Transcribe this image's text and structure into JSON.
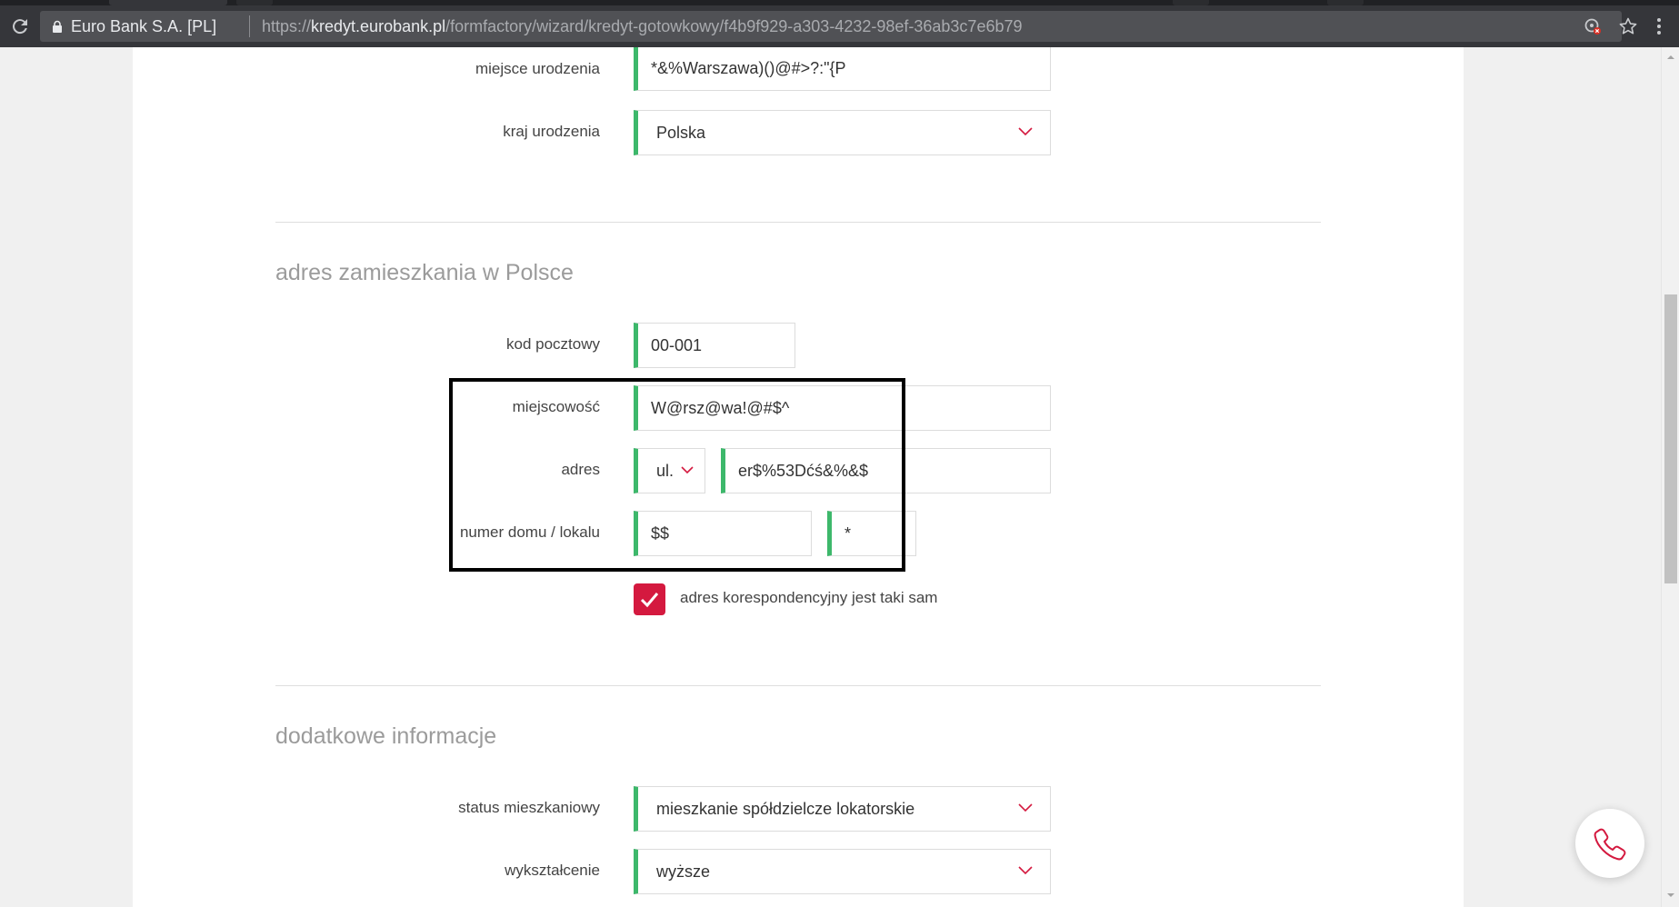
{
  "browser": {
    "site_name": "Euro Bank S.A. [PL]",
    "url_scheme": "https://",
    "url_host": "kredyt.eurobank.pl",
    "url_path": "/formfactory/wizard/kredyt-gotowkowy/f4b9f929-a303-4232-98ef-36ab3c7e6b79"
  },
  "form": {
    "birth_place": {
      "label": "miejsce urodzenia",
      "value": "*&%Warszawa)()@#>?:\"{P"
    },
    "birth_country": {
      "label": "kraj urodzenia",
      "value": "Polska"
    },
    "address_section": {
      "title": "adres zamieszkania w Polsce",
      "postal_code": {
        "label": "kod pocztowy",
        "value": "00-001"
      },
      "city": {
        "label": "miejscowość",
        "value": "W@rsz@wa!@#$^"
      },
      "address": {
        "label": "adres",
        "street_type": "ul.",
        "value": "er$%53Dćś&%&$"
      },
      "house_number": {
        "label": "numer domu / lokalu",
        "house": "$$",
        "flat": "*"
      },
      "same_correspondence": {
        "label": "adres korespondencyjny jest taki sam",
        "checked": true
      }
    },
    "additional_section": {
      "title": "dodatkowe informacje",
      "housing_status": {
        "label": "status mieszkaniowy",
        "value": "mieszkanie spółdzielcze lokatorskie"
      },
      "education": {
        "label": "wykształcenie",
        "value": "wyższe"
      }
    }
  },
  "colors": {
    "field_accent": "#3db86b",
    "checkbox": "#d4193f",
    "chevron": "#d4193f",
    "highlight_box": "#000000"
  },
  "icons": {
    "reload": "reload-icon",
    "lock": "lock-icon",
    "blocked": "blocked-content-icon",
    "star": "bookmark-star-icon",
    "menu": "more-vert-icon",
    "check": "check-icon",
    "chevron": "chevron-down-icon",
    "phone": "phone-icon"
  }
}
